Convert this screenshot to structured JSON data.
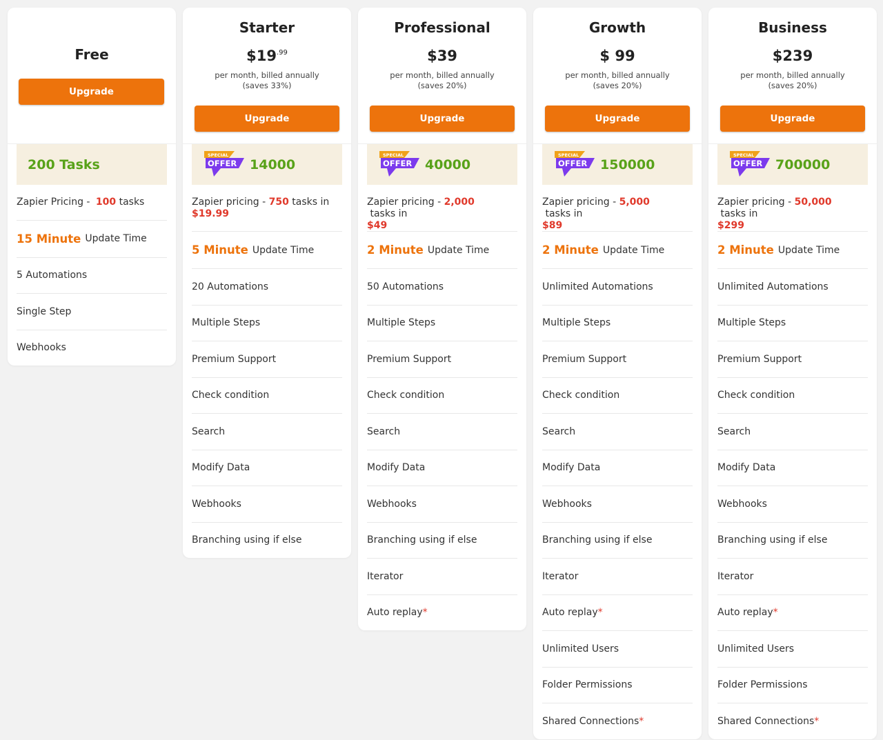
{
  "colors": {
    "accent": "#ed730c",
    "green": "#58a219",
    "red": "#e0392b",
    "offer_purple": "#7c3aed",
    "offer_orange": "#f0a21a"
  },
  "free": {
    "name": "Free",
    "button": "Upgrade",
    "tasks": "200 Tasks",
    "pricing_prefix": "Zapier Pricing - ",
    "pricing_count": "100",
    "pricing_suffix": " tasks",
    "update_value": "15 Minute",
    "update_label": "Update Time",
    "features": [
      "5 Automations",
      "Single Step",
      "Webhooks"
    ]
  },
  "plans": [
    {
      "name": "Starter",
      "price": "$19",
      "price_cents": ".99",
      "billing": "per month, billed annually",
      "saves": "(saves 33%)",
      "button": "Upgrade",
      "offer_top": "SPECIAL",
      "offer_main": "OFFER",
      "tasks": "14000",
      "pricing_prefix": "Zapier pricing - ",
      "pricing_count": "750",
      "pricing_mid": " tasks in ",
      "pricing_price": "$19.99",
      "update_value": "5 Minute",
      "update_label": "Update Time",
      "features": [
        "20 Automations",
        "Multiple Steps",
        "Premium Support",
        "Check condition",
        "Search",
        "Modify Data",
        "Webhooks",
        "Branching using if else"
      ]
    },
    {
      "name": "Professional",
      "price": "$39",
      "price_cents": "",
      "billing": "per month, billed annually",
      "saves": "(saves 20%)",
      "button": "Upgrade",
      "offer_top": "SPECIAL",
      "offer_main": "OFFER",
      "tasks": "40000",
      "pricing_prefix": "Zapier pricing - ",
      "pricing_count": "2,000",
      "pricing_mid": " tasks in ",
      "pricing_price": "$49",
      "update_value": "2 Minute",
      "update_label": "Update Time",
      "features": [
        "50 Automations",
        "Multiple Steps",
        "Premium Support",
        "Check condition",
        "Search",
        "Modify Data",
        "Webhooks",
        "Branching using if else",
        "Iterator",
        "Auto replay"
      ]
    },
    {
      "name": "Growth",
      "price": "$ 99",
      "price_cents": "",
      "billing": "per month, billed annually",
      "saves": "(saves 20%)",
      "button": "Upgrade",
      "offer_top": "SPECIAL",
      "offer_main": "OFFER",
      "tasks": "150000",
      "pricing_prefix": "Zapier pricing - ",
      "pricing_count": "5,000",
      "pricing_mid": " tasks in ",
      "pricing_price": "$89",
      "update_value": "2 Minute",
      "update_label": "Update Time",
      "features": [
        "Unlimited Automations",
        "Multiple Steps",
        "Premium Support",
        "Check condition",
        "Search",
        "Modify Data",
        "Webhooks",
        "Branching using if else",
        "Iterator",
        "Auto replay",
        "Unlimited Users",
        "Folder Permissions",
        "Shared Connections"
      ]
    },
    {
      "name": "Business",
      "price": "$239",
      "price_cents": "",
      "billing": "per month, billed annually",
      "saves": "(saves 20%)",
      "button": "Upgrade",
      "offer_top": "SPECIAL",
      "offer_main": "OFFER",
      "tasks": "700000",
      "pricing_prefix": "Zapier pricing - ",
      "pricing_count": "50,000",
      "pricing_mid": " tasks in ",
      "pricing_price": "$299",
      "update_value": "2 Minute",
      "update_label": "Update Time",
      "features": [
        "Unlimited Automations",
        "Multiple Steps",
        "Premium Support",
        "Check condition",
        "Search",
        "Modify Data",
        "Webhooks",
        "Branching using if else",
        "Iterator",
        "Auto replay",
        "Unlimited Users",
        "Folder Permissions",
        "Shared Connections"
      ]
    }
  ],
  "starred_features": [
    "Auto replay",
    "Shared Connections"
  ],
  "star_mark": "*"
}
